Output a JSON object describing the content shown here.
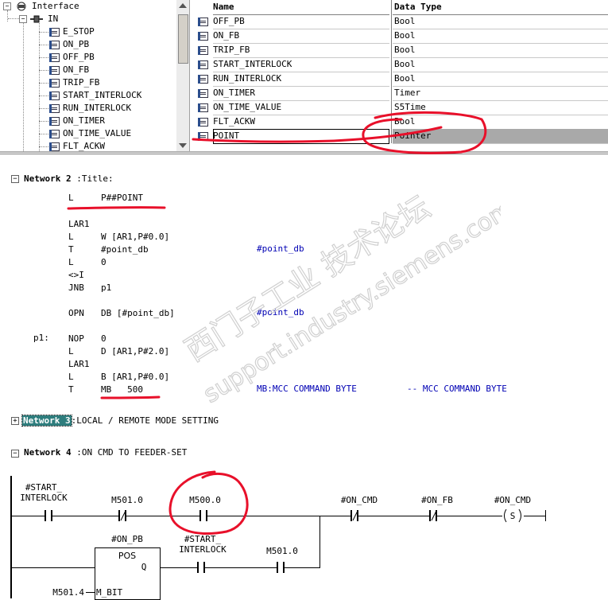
{
  "interface_tree": {
    "root_label": "Interface",
    "in_label": "IN",
    "items": [
      "E_STOP",
      "ON_PB",
      "OFF_PB",
      "ON_FB",
      "TRIP_FB",
      "START_INTERLOCK",
      "RUN_INTERLOCK",
      "ON_TIMER",
      "ON_TIME_VALUE",
      "FLT_ACKW"
    ]
  },
  "decl_table": {
    "columns": [
      "Name",
      "Data Type"
    ],
    "rows": [
      {
        "name": "OFF_PB",
        "type": "Bool"
      },
      {
        "name": "ON_FB",
        "type": "Bool"
      },
      {
        "name": "TRIP_FB",
        "type": "Bool"
      },
      {
        "name": "START_INTERLOCK",
        "type": "Bool"
      },
      {
        "name": "RUN_INTERLOCK",
        "type": "Bool"
      },
      {
        "name": "ON_TIMER",
        "type": "Timer"
      },
      {
        "name": "ON_TIME_VALUE",
        "type": "S5Time"
      },
      {
        "name": "FLT_ACKW",
        "type": "Bool"
      },
      {
        "name": "POINT",
        "type": "Pointer"
      }
    ]
  },
  "network2": {
    "label": "Network 2",
    "sep": ":",
    "title": "Title:",
    "lines": [
      {
        "op": "L",
        "arg": "P##POINT"
      },
      {
        "op": "LAR1",
        "arg": ""
      },
      {
        "op": "L",
        "arg": "W [AR1,P#0.0]"
      },
      {
        "op": "T",
        "arg": "#point_db",
        "comment": "#point_db"
      },
      {
        "op": "L",
        "arg": "0"
      },
      {
        "op": "<>I",
        "arg": ""
      },
      {
        "op": "JNB",
        "arg": "p1"
      },
      {
        "op": "OPN",
        "arg": "DB [#point_db]",
        "comment": "#point_db"
      },
      {
        "label": "p1:",
        "op": "NOP",
        "arg": "0"
      },
      {
        "op": "L",
        "arg": "D [AR1,P#2.0]"
      },
      {
        "op": "LAR1",
        "arg": ""
      },
      {
        "op": "L",
        "arg": "B [AR1,P#0.0]"
      },
      {
        "op": "T",
        "arg": "MB   500",
        "comment": "MB:MCC COMMAND BYTE",
        "comment2": "-- MCC COMMAND BYTE"
      }
    ]
  },
  "network3": {
    "label": "Network 3",
    "sep": ":",
    "title": "LOCAL / REMOTE MODE SETTING"
  },
  "network4": {
    "label": "Network 4",
    "sep": ":",
    "title": "ON CMD TO FEEDER-SET",
    "contacts": [
      {
        "op1": "#START_",
        "op2": "INTERLOCK"
      },
      {
        "op1": "M501.0",
        "op2": ""
      },
      {
        "op1": "M500.0",
        "op2": ""
      },
      {
        "op1": "#ON_CMD",
        "op2": ""
      },
      {
        "op1": "#ON_FB",
        "op2": ""
      },
      {
        "op1": "#ON_CMD",
        "op2": "S"
      }
    ],
    "pos_box": {
      "operand": "#ON_PB",
      "name": "POS",
      "out": "Q",
      "in": "M_BIT",
      "in_operand": "M501.4"
    },
    "lower_contacts": [
      {
        "op1": "#START_",
        "op2": "INTERLOCK"
      },
      {
        "op1": "M501.0",
        "op2": ""
      }
    ]
  },
  "watermark": {
    "line1": "西门子工业  技术论坛",
    "line2": "support.industry.siemens.com/cs"
  },
  "colors": {
    "comment": "#0000b4",
    "selected_row": "#a9a9a9",
    "annotation": "#e8102a",
    "net3_highlight": "#2e7d7d"
  }
}
